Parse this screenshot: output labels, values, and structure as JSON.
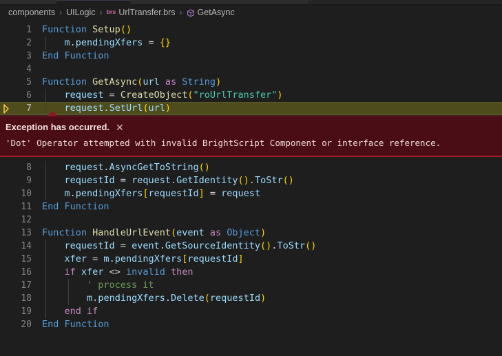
{
  "window": {
    "background": "#1e1e1e",
    "tab_strip_background": "#252526"
  },
  "breadcrumb": {
    "name": "breadcrumb",
    "items": [
      {
        "label": "components",
        "icon": null
      },
      {
        "label": "UILogic",
        "icon": null
      },
      {
        "label": "UrlTransfer.brs",
        "icon": "brs-file-icon",
        "icon_text": "brs",
        "icon_color": "#d76ba8"
      },
      {
        "label": "GetAsync",
        "icon": "symbol-object-icon",
        "icon_color": "#b180d7"
      }
    ],
    "separator": "›"
  },
  "editor": {
    "name": "code-editor",
    "language": "BrightScript",
    "current_line": 7,
    "current_line_highlight_color": "#4e4c1c",
    "debug_pointer_color": "#ffd33d",
    "lines": [
      {
        "number": "1",
        "indent": 0,
        "tokens": [
          {
            "t": "Function",
            "c": "t-kw"
          },
          {
            "t": " ",
            "c": "t-plain"
          },
          {
            "t": "Setup",
            "c": "t-fn"
          },
          {
            "t": "(",
            "c": "t-paren"
          },
          {
            "t": ")",
            "c": "t-paren"
          }
        ]
      },
      {
        "number": "2",
        "indent": 1,
        "tokens": [
          {
            "t": "    ",
            "c": "t-plain"
          },
          {
            "t": "m",
            "c": "t-var"
          },
          {
            "t": ".",
            "c": "t-punct"
          },
          {
            "t": "pendingXfers",
            "c": "t-var"
          },
          {
            "t": " = ",
            "c": "t-plain"
          },
          {
            "t": "{",
            "c": "t-brace"
          },
          {
            "t": "}",
            "c": "t-brace"
          }
        ]
      },
      {
        "number": "3",
        "indent": 0,
        "tokens": [
          {
            "t": "End Function",
            "c": "t-kw"
          }
        ]
      },
      {
        "number": "4",
        "indent": 0,
        "tokens": []
      },
      {
        "number": "5",
        "indent": 0,
        "tokens": [
          {
            "t": "Function",
            "c": "t-kw"
          },
          {
            "t": " ",
            "c": "t-plain"
          },
          {
            "t": "GetAsync",
            "c": "t-fn"
          },
          {
            "t": "(",
            "c": "t-paren"
          },
          {
            "t": "url",
            "c": "t-var"
          },
          {
            "t": " ",
            "c": "t-plain"
          },
          {
            "t": "as",
            "c": "t-kw2"
          },
          {
            "t": " ",
            "c": "t-plain"
          },
          {
            "t": "String",
            "c": "t-kw"
          },
          {
            "t": ")",
            "c": "t-paren"
          }
        ]
      },
      {
        "number": "6",
        "indent": 1,
        "tokens": [
          {
            "t": "    ",
            "c": "t-plain"
          },
          {
            "t": "request",
            "c": "t-var"
          },
          {
            "t": " = ",
            "c": "t-plain"
          },
          {
            "t": "CreateObject",
            "c": "t-fn"
          },
          {
            "t": "(",
            "c": "t-paren"
          },
          {
            "t": "\"roUrlTransfer\"",
            "c": "t-str2"
          },
          {
            "t": ")",
            "c": "t-paren"
          }
        ]
      },
      {
        "number": "7",
        "indent": 1,
        "current": true,
        "tokens": [
          {
            "t": "    ",
            "c": "t-plain"
          },
          {
            "t": "request",
            "c": "t-var"
          },
          {
            "t": ".",
            "c": "t-punct"
          },
          {
            "t": "SetUrl",
            "c": "t-var"
          },
          {
            "t": "(",
            "c": "t-paren"
          },
          {
            "t": "url",
            "c": "t-var"
          },
          {
            "t": ")",
            "c": "t-paren"
          }
        ]
      },
      {
        "number": "8",
        "indent": 1,
        "tokens": [
          {
            "t": "    ",
            "c": "t-plain"
          },
          {
            "t": "request",
            "c": "t-var"
          },
          {
            "t": ".",
            "c": "t-punct"
          },
          {
            "t": "AsyncGetToString",
            "c": "t-var"
          },
          {
            "t": "(",
            "c": "t-paren"
          },
          {
            "t": ")",
            "c": "t-paren"
          }
        ]
      },
      {
        "number": "9",
        "indent": 1,
        "tokens": [
          {
            "t": "    ",
            "c": "t-plain"
          },
          {
            "t": "requestId",
            "c": "t-var"
          },
          {
            "t": " = ",
            "c": "t-plain"
          },
          {
            "t": "request",
            "c": "t-var"
          },
          {
            "t": ".",
            "c": "t-punct"
          },
          {
            "t": "GetIdentity",
            "c": "t-var"
          },
          {
            "t": "(",
            "c": "t-paren"
          },
          {
            "t": ")",
            "c": "t-paren"
          },
          {
            "t": ".",
            "c": "t-punct"
          },
          {
            "t": "ToStr",
            "c": "t-var"
          },
          {
            "t": "(",
            "c": "t-paren"
          },
          {
            "t": ")",
            "c": "t-paren"
          }
        ]
      },
      {
        "number": "10",
        "indent": 1,
        "tokens": [
          {
            "t": "    ",
            "c": "t-plain"
          },
          {
            "t": "m",
            "c": "t-var"
          },
          {
            "t": ".",
            "c": "t-punct"
          },
          {
            "t": "pendingXfers",
            "c": "t-var"
          },
          {
            "t": "[",
            "c": "t-paren"
          },
          {
            "t": "requestId",
            "c": "t-var"
          },
          {
            "t": "]",
            "c": "t-paren"
          },
          {
            "t": " = ",
            "c": "t-plain"
          },
          {
            "t": "request",
            "c": "t-var"
          }
        ]
      },
      {
        "number": "11",
        "indent": 0,
        "tokens": [
          {
            "t": "End Function",
            "c": "t-kw"
          }
        ]
      },
      {
        "number": "12",
        "indent": 0,
        "tokens": []
      },
      {
        "number": "13",
        "indent": 0,
        "tokens": [
          {
            "t": "Function",
            "c": "t-kw"
          },
          {
            "t": " ",
            "c": "t-plain"
          },
          {
            "t": "HandleUrlEvent",
            "c": "t-fn"
          },
          {
            "t": "(",
            "c": "t-paren"
          },
          {
            "t": "event",
            "c": "t-var"
          },
          {
            "t": " ",
            "c": "t-plain"
          },
          {
            "t": "as",
            "c": "t-kw2"
          },
          {
            "t": " ",
            "c": "t-plain"
          },
          {
            "t": "Object",
            "c": "t-kw"
          },
          {
            "t": ")",
            "c": "t-paren"
          }
        ]
      },
      {
        "number": "14",
        "indent": 1,
        "tokens": [
          {
            "t": "    ",
            "c": "t-plain"
          },
          {
            "t": "requestId",
            "c": "t-var"
          },
          {
            "t": " = ",
            "c": "t-plain"
          },
          {
            "t": "event",
            "c": "t-var"
          },
          {
            "t": ".",
            "c": "t-punct"
          },
          {
            "t": "GetSourceIdentity",
            "c": "t-var"
          },
          {
            "t": "(",
            "c": "t-paren"
          },
          {
            "t": ")",
            "c": "t-paren"
          },
          {
            "t": ".",
            "c": "t-punct"
          },
          {
            "t": "ToStr",
            "c": "t-var"
          },
          {
            "t": "(",
            "c": "t-paren"
          },
          {
            "t": ")",
            "c": "t-paren"
          }
        ]
      },
      {
        "number": "15",
        "indent": 1,
        "tokens": [
          {
            "t": "    ",
            "c": "t-plain"
          },
          {
            "t": "xfer",
            "c": "t-var"
          },
          {
            "t": " = ",
            "c": "t-plain"
          },
          {
            "t": "m",
            "c": "t-var"
          },
          {
            "t": ".",
            "c": "t-punct"
          },
          {
            "t": "pendingXfers",
            "c": "t-var"
          },
          {
            "t": "[",
            "c": "t-paren"
          },
          {
            "t": "requestId",
            "c": "t-var"
          },
          {
            "t": "]",
            "c": "t-paren"
          }
        ]
      },
      {
        "number": "16",
        "indent": 1,
        "tokens": [
          {
            "t": "    ",
            "c": "t-plain"
          },
          {
            "t": "if",
            "c": "t-kw2"
          },
          {
            "t": " ",
            "c": "t-plain"
          },
          {
            "t": "xfer",
            "c": "t-var"
          },
          {
            "t": " <> ",
            "c": "t-plain"
          },
          {
            "t": "invalid",
            "c": "t-kw"
          },
          {
            "t": " ",
            "c": "t-plain"
          },
          {
            "t": "then",
            "c": "t-kw2"
          }
        ]
      },
      {
        "number": "17",
        "indent": 2,
        "tokens": [
          {
            "t": "        ' process it",
            "c": "t-comment"
          }
        ]
      },
      {
        "number": "18",
        "indent": 2,
        "tokens": [
          {
            "t": "        ",
            "c": "t-plain"
          },
          {
            "t": "m",
            "c": "t-var"
          },
          {
            "t": ".",
            "c": "t-punct"
          },
          {
            "t": "pendingXfers",
            "c": "t-var"
          },
          {
            "t": ".",
            "c": "t-punct"
          },
          {
            "t": "Delete",
            "c": "t-var"
          },
          {
            "t": "(",
            "c": "t-paren"
          },
          {
            "t": "requestId",
            "c": "t-var"
          },
          {
            "t": ")",
            "c": "t-paren"
          }
        ]
      },
      {
        "number": "19",
        "indent": 1,
        "tokens": [
          {
            "t": "    ",
            "c": "t-plain"
          },
          {
            "t": "end if",
            "c": "t-kw2"
          }
        ]
      },
      {
        "number": "20",
        "indent": 0,
        "tokens": [
          {
            "t": "End Function",
            "c": "t-kw"
          }
        ]
      }
    ]
  },
  "exception": {
    "name": "exception-widget",
    "title": "Exception has occurred.",
    "close_label": "✕",
    "message": "'Dot' Operator attempted with invalid BrightScript Component or interface reference.",
    "background": "#4b0d15",
    "border_color": "#a01b28"
  }
}
